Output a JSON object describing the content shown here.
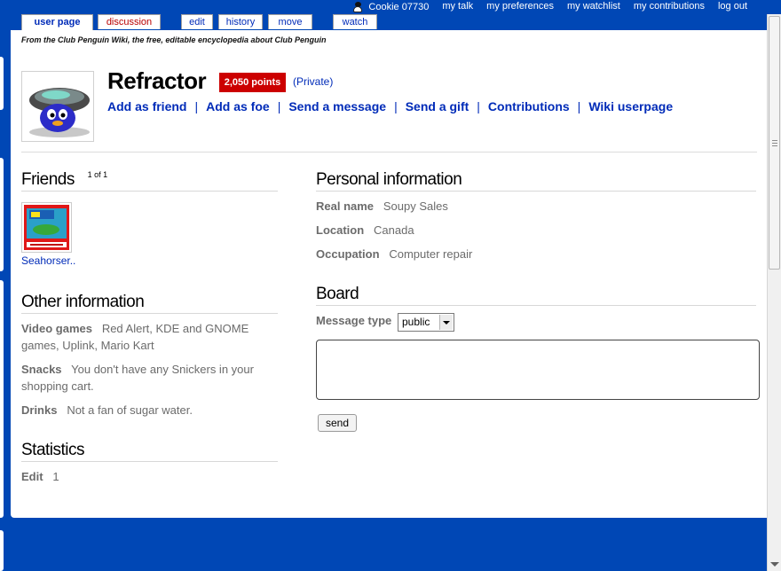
{
  "personal_bar": {
    "username": "Cookie 07730",
    "links": [
      "my talk",
      "my preferences",
      "my watchlist",
      "my contributions",
      "log out"
    ]
  },
  "tabs": [
    "user page",
    "discussion",
    "edit",
    "history",
    "move",
    "watch"
  ],
  "site_sub": "From the Club Penguin Wiki, the free, editable encyclopedia about Club Penguin",
  "profile": {
    "username": "Refractor",
    "points": "2,050 points",
    "privacy": "(Private)",
    "actions": [
      "Add as friend",
      "Add as foe",
      "Send a message",
      "Send a gift",
      "Contributions",
      "Wiki userpage"
    ]
  },
  "friends": {
    "title": "Friends",
    "count": "1 of 1",
    "items": [
      {
        "name": "Seahorser.."
      }
    ]
  },
  "other_info": {
    "title": "Other information",
    "video_games_label": "Video games",
    "video_games_value": "Red Alert, KDE and GNOME",
    "video_games_value2": "games, Uplink, Mario Kart",
    "snacks_label": "Snacks",
    "snacks_value": "You don't have any Snickers in your",
    "snacks_value2": "shopping cart.",
    "drinks_label": "Drinks",
    "drinks_value": "Not a fan of sugar water."
  },
  "statistics": {
    "title": "Statistics",
    "edit_label": "Edit",
    "edit_value": "1"
  },
  "personal_info": {
    "title": "Personal information",
    "real_name_label": "Real name",
    "real_name_value": "Soupy Sales",
    "location_label": "Location",
    "location_value": "Canada",
    "occupation_label": "Occupation",
    "occupation_value": "Computer repair"
  },
  "board": {
    "title": "Board",
    "message_type_label": "Message type",
    "message_type_selected": "public",
    "send_label": "send"
  },
  "colors": {
    "background": "#0047b5",
    "link": "#002bb8",
    "points_badge": "#cc0000"
  }
}
